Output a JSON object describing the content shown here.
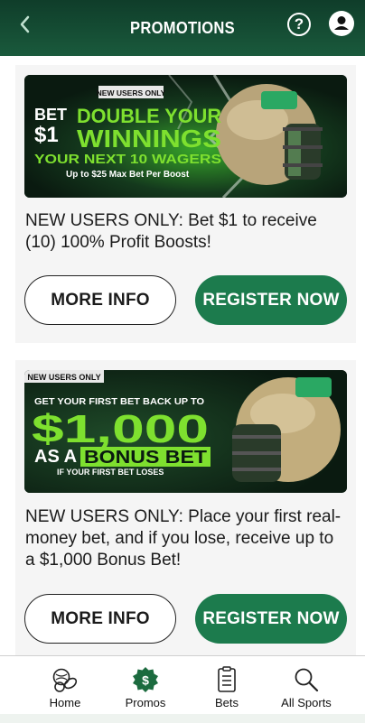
{
  "header": {
    "title": "PROMOTIONS",
    "help_glyph": "?"
  },
  "colors": {
    "brand_dark": "#0f3d2a",
    "brand_green": "#1c7b4d",
    "promo_lime": "#7ee02f"
  },
  "promos": [
    {
      "banner": {
        "tag": "NEW USERS ONLY",
        "line_small_left": "BET",
        "line_big_left": "$1",
        "headline_1": "DOUBLE YOUR",
        "headline_2": "WINNINGS",
        "headline_3": "YOUR NEXT 10 WAGERS",
        "fine_print": "Up to $25 Max Bet Per Boost"
      },
      "description": "NEW USERS ONLY: Bet $1 to receive (10) 100% Profit Boosts!",
      "more_info_label": "MORE INFO",
      "register_label": "REGISTER NOW"
    },
    {
      "banner": {
        "tag": "NEW USERS ONLY",
        "line_1": "GET YOUR FIRST BET BACK UP TO",
        "amount": "$1,000",
        "line_as_a": "AS A",
        "line_bonus": "BONUS BET",
        "line_last": "IF YOUR FIRST BET LOSES"
      },
      "description": "NEW USERS ONLY: Place your first real-money bet, and if you lose, receive up to a $1,000 Bonus Bet!",
      "more_info_label": "MORE INFO",
      "register_label": "REGISTER NOW"
    }
  ],
  "nav": {
    "home": "Home",
    "promos": "Promos",
    "bets": "Bets",
    "sports": "All Sports"
  }
}
